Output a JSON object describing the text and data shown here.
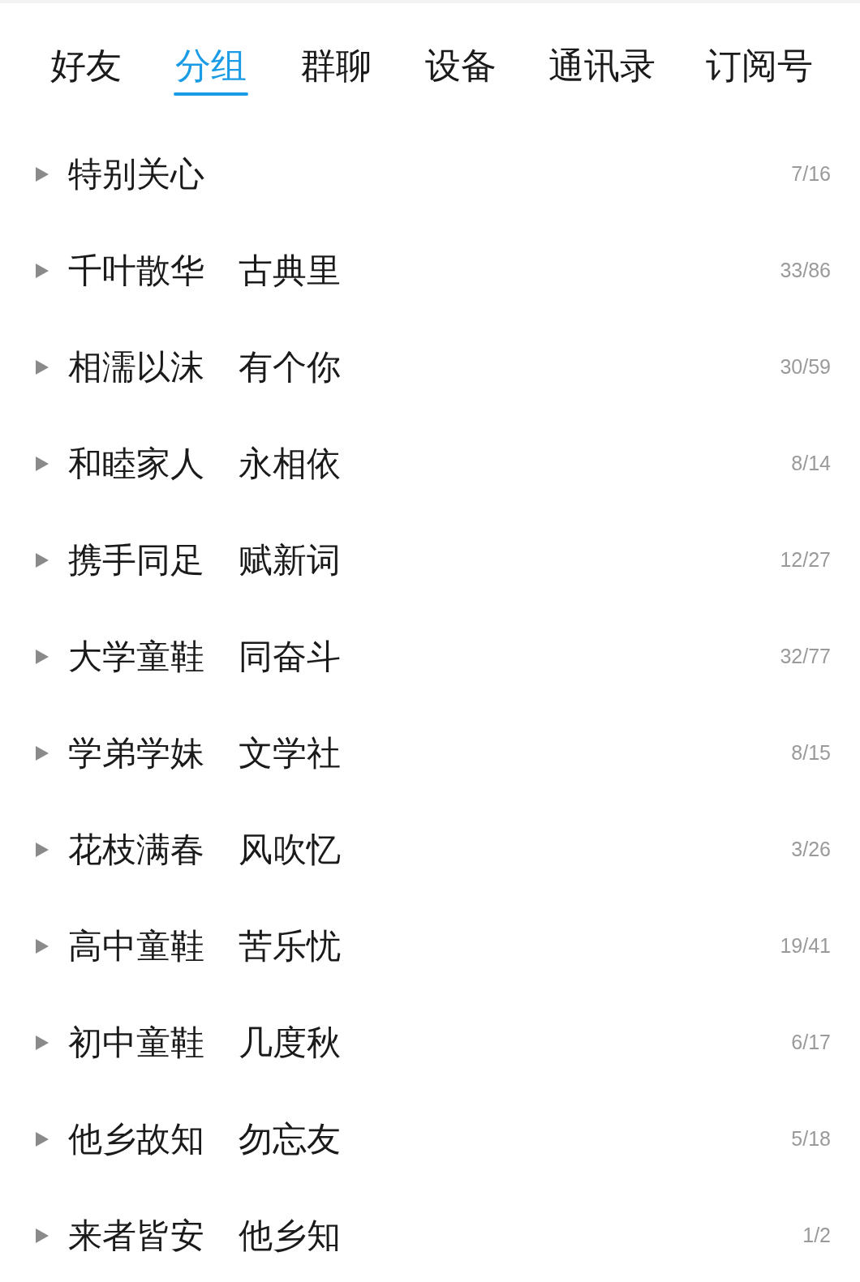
{
  "tabs": [
    {
      "label": "好友",
      "selected": false
    },
    {
      "label": "分组",
      "selected": true
    },
    {
      "label": "群聊",
      "selected": false
    },
    {
      "label": "设备",
      "selected": false
    },
    {
      "label": "通讯录",
      "selected": false
    },
    {
      "label": "订阅号",
      "selected": false
    }
  ],
  "groups": [
    {
      "name": "特别关心",
      "count": "7/16",
      "expanded": false
    },
    {
      "name": "千叶散华　古典里",
      "count": "33/86",
      "expanded": false
    },
    {
      "name": "相濡以沫　有个你",
      "count": "30/59",
      "expanded": false
    },
    {
      "name": "和睦家人　永相依",
      "count": "8/14",
      "expanded": false
    },
    {
      "name": "携手同足　赋新词",
      "count": "12/27",
      "expanded": false
    },
    {
      "name": "大学童鞋　同奋斗",
      "count": "32/77",
      "expanded": false
    },
    {
      "name": "学弟学妹　文学社",
      "count": "8/15",
      "expanded": false
    },
    {
      "name": "花枝满春　风吹忆",
      "count": "3/26",
      "expanded": false
    },
    {
      "name": "高中童鞋　苦乐忧",
      "count": "19/41",
      "expanded": false
    },
    {
      "name": "初中童鞋　几度秋",
      "count": "6/17",
      "expanded": false
    },
    {
      "name": "他乡故知　勿忘友",
      "count": "5/18",
      "expanded": false
    },
    {
      "name": "来者皆安　他乡知",
      "count": "1/2",
      "expanded": false
    }
  ]
}
